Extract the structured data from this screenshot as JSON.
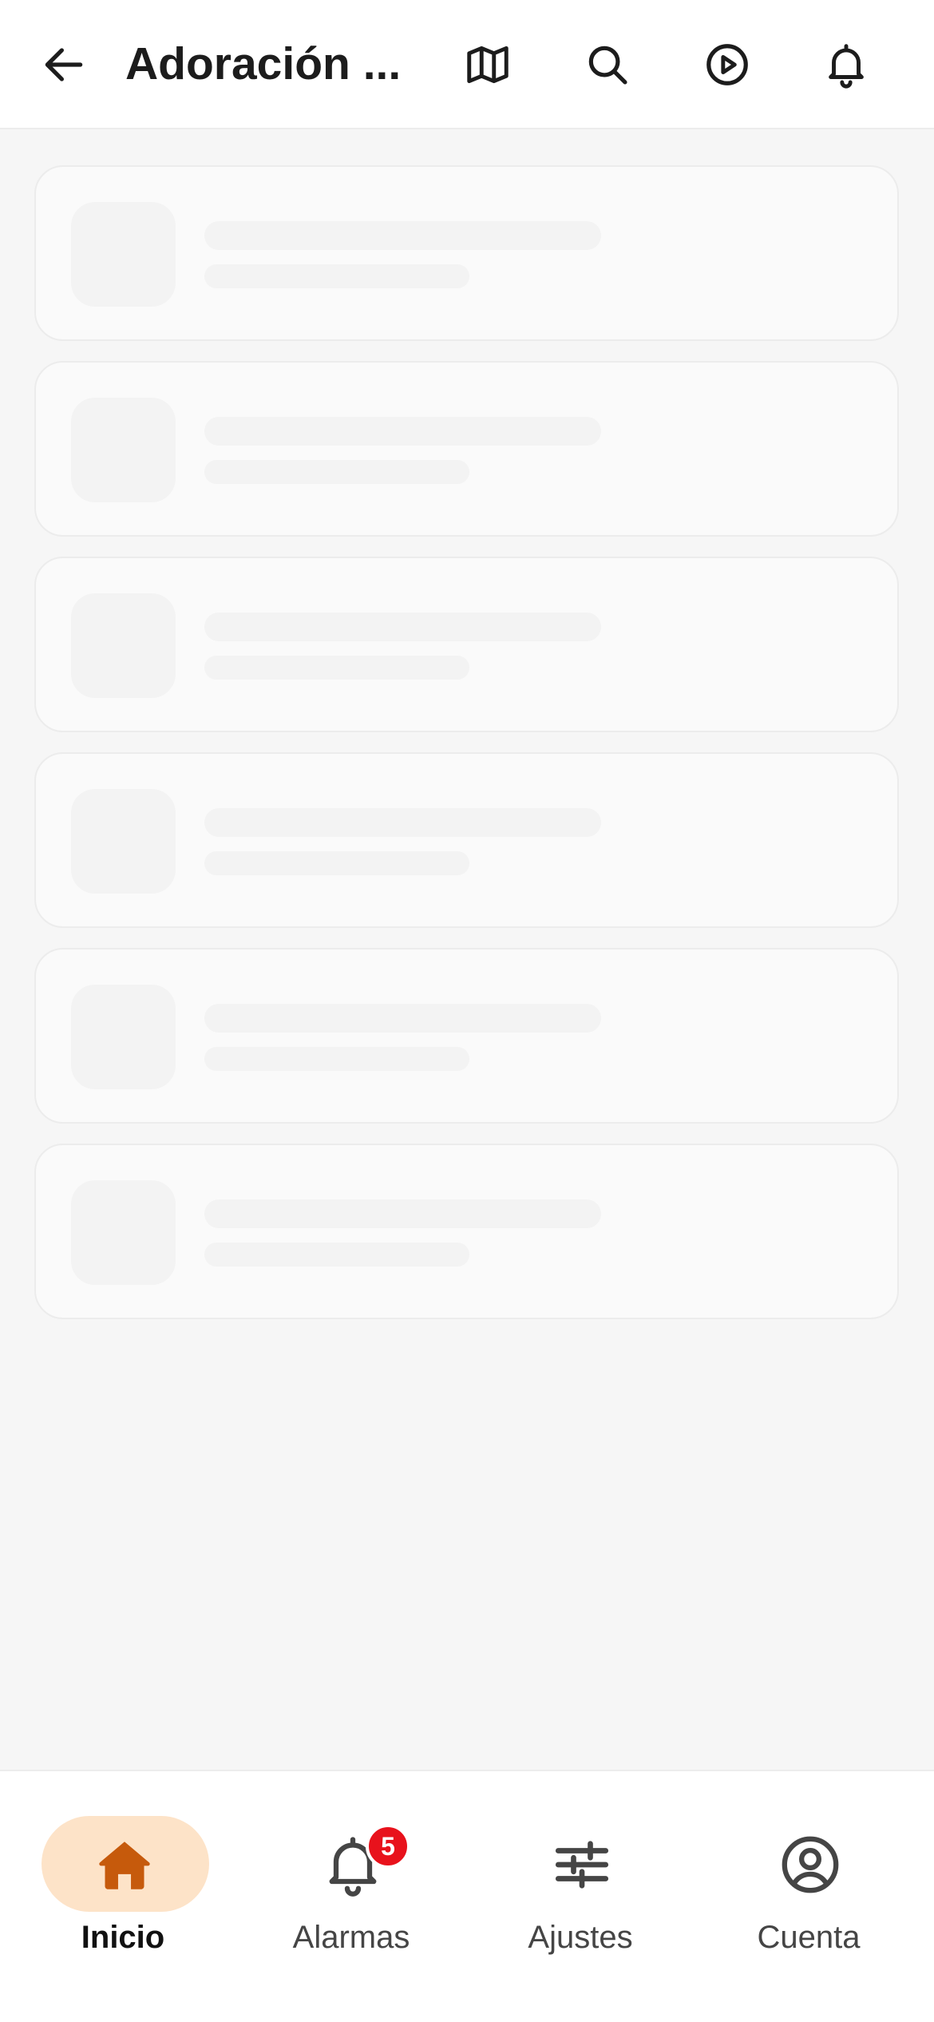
{
  "header": {
    "title": "Adoración ...",
    "back_icon": "arrow-left-icon",
    "actions": [
      {
        "icon": "map-icon"
      },
      {
        "icon": "search-icon"
      },
      {
        "icon": "play-circle-icon"
      },
      {
        "icon": "bell-icon"
      }
    ]
  },
  "content": {
    "state": "loading",
    "skeleton_cards": 6
  },
  "bottom_nav": {
    "items": [
      {
        "label": "Inicio",
        "icon": "home-icon",
        "active": true
      },
      {
        "label": "Alarmas",
        "icon": "bell-icon",
        "badge": "5"
      },
      {
        "label": "Ajustes",
        "icon": "sliders-icon"
      },
      {
        "label": "Cuenta",
        "icon": "user-circle-icon"
      }
    ]
  },
  "colors": {
    "accent": "#c65a0c",
    "accent_bg": "#fde3c8",
    "badge": "#e8121c",
    "skeleton": "#f3f3f3",
    "background": "#f6f6f6"
  }
}
